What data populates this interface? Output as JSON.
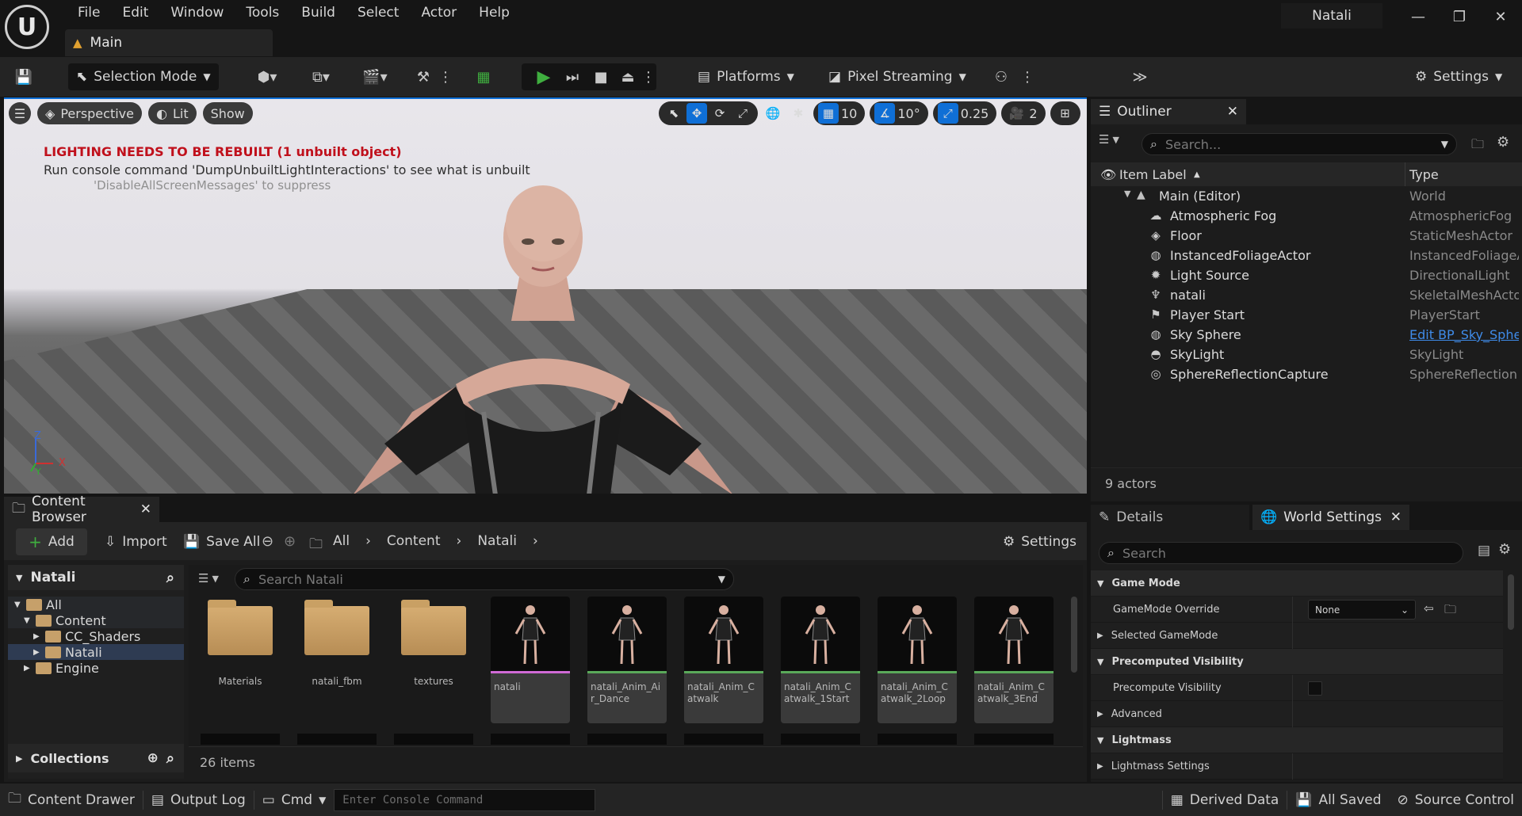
{
  "app": {
    "project_name": "Natali",
    "doc_tab": "Main"
  },
  "menu": [
    "File",
    "Edit",
    "Window",
    "Tools",
    "Build",
    "Select",
    "Actor",
    "Help"
  ],
  "toolbar": {
    "selection_mode": "Selection Mode",
    "platforms": "Platforms",
    "pixel_streaming": "Pixel Streaming",
    "settings": "Settings"
  },
  "viewport": {
    "perspective": "Perspective",
    "lit": "Lit",
    "show": "Show",
    "grid_snap": "10",
    "rot_snap": "10°",
    "scale_snap": "0.25",
    "cam_speed": "2",
    "msg_red": "LIGHTING NEEDS TO BE REBUILT (1 unbuilt object)",
    "msg_1": "Run console command 'DumpUnbuiltLightInteractions' to see what is unbuilt",
    "msg_2": "'DisableAllScreenMessages' to suppress",
    "axis_z": "Z",
    "axis_x": "X",
    "axis_y": "Y"
  },
  "outliner": {
    "tab": "Outliner",
    "search_placeholder": "Search...",
    "col_label": "Item Label",
    "col_type": "Type",
    "root": {
      "label": "Main (Editor)",
      "type": "World"
    },
    "items": [
      {
        "label": "Atmospheric Fog",
        "type": "AtmosphericFog",
        "icon": "cloud-icon"
      },
      {
        "label": "Floor",
        "type": "StaticMeshActor",
        "icon": "cube-icon"
      },
      {
        "label": "InstancedFoliageActor",
        "type": "InstancedFoliageA",
        "icon": "sphere-icon"
      },
      {
        "label": "Light Source",
        "type": "DirectionalLight",
        "icon": "sun-icon"
      },
      {
        "label": "natali",
        "type": "SkeletalMeshActo",
        "icon": "skeleton-icon"
      },
      {
        "label": "Player Start",
        "type": "PlayerStart",
        "icon": "flag-icon"
      },
      {
        "label": "Sky Sphere",
        "type": "Edit BP_Sky_Sphe",
        "icon": "sphere-icon"
      },
      {
        "label": "SkyLight",
        "type": "SkyLight",
        "icon": "skylight-icon"
      },
      {
        "label": "SphereReflectionCapture",
        "type": "SphereReflection",
        "icon": "capture-icon"
      }
    ],
    "count": "9 actors"
  },
  "details": {
    "tab_details": "Details",
    "tab_world": "World Settings",
    "search_placeholder": "Search",
    "rows": [
      {
        "kind": "section",
        "label": "Game Mode",
        "open": true
      },
      {
        "kind": "prop",
        "label": "GameMode Override",
        "value": "None"
      },
      {
        "kind": "sub",
        "label": "Selected GameMode"
      },
      {
        "kind": "section",
        "label": "Precomputed Visibility",
        "open": true
      },
      {
        "kind": "check",
        "label": "Precompute Visibility"
      },
      {
        "kind": "sub",
        "label": "Advanced"
      },
      {
        "kind": "section",
        "label": "Lightmass",
        "open": true
      },
      {
        "kind": "sub",
        "label": "Lightmass Settings"
      }
    ]
  },
  "content_browser": {
    "tab": "Content Browser",
    "add": "Add",
    "import": "Import",
    "save_all": "Save All",
    "breadcrumb": [
      "All",
      "Content",
      "Natali"
    ],
    "settings": "Settings",
    "tree_header": "Natali",
    "tree": [
      {
        "label": "All",
        "depth": 0
      },
      {
        "label": "Content",
        "depth": 1
      },
      {
        "label": "CC_Shaders",
        "depth": 2
      },
      {
        "label": "Natali",
        "depth": 2
      },
      {
        "label": "Engine",
        "depth": 1
      }
    ],
    "collections": "Collections",
    "search_placeholder": "Search Natali",
    "folders": [
      "Materials",
      "natali_fbm",
      "textures"
    ],
    "assets": [
      {
        "label": "natali",
        "bar": "#d06ad6"
      },
      {
        "label": "natali_Anim_Air_Dance",
        "bar": "#5aa95a"
      },
      {
        "label": "natali_Anim_Catwalk",
        "bar": "#5aa95a"
      },
      {
        "label": "natali_Anim_Catwalk_1Start",
        "bar": "#5aa95a"
      },
      {
        "label": "natali_Anim_Catwalk_2Loop",
        "bar": "#5aa95a"
      },
      {
        "label": "natali_Anim_Catwalk_3End",
        "bar": "#5aa95a"
      }
    ],
    "count": "26 items"
  },
  "status": {
    "content_drawer": "Content Drawer",
    "output_log": "Output Log",
    "cmd": "Cmd",
    "console_placeholder": "Enter Console Command",
    "derived_data": "Derived Data",
    "all_saved": "All Saved",
    "source_control": "Source Control"
  },
  "colors": {
    "accent": "#0f6fd6",
    "play": "#3fae3f",
    "warning": "#c0101c"
  }
}
